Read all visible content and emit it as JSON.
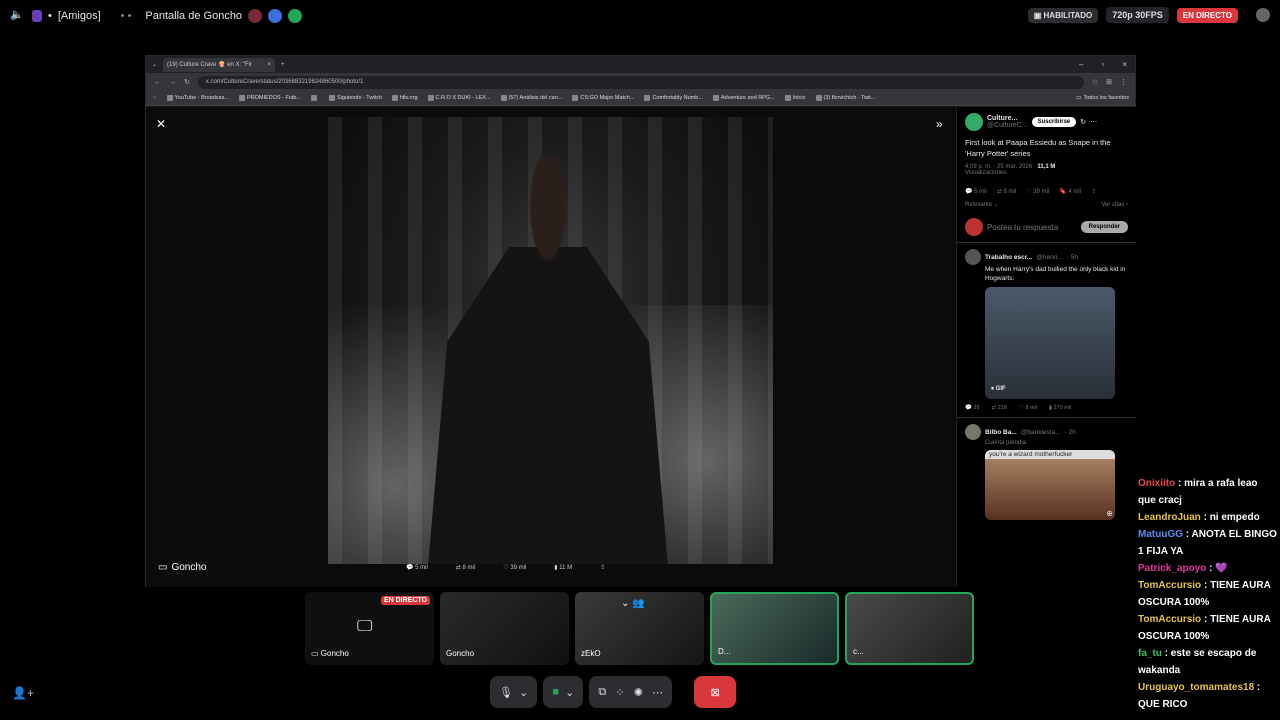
{
  "topbar": {
    "server": "[Amigos]",
    "separator": "•",
    "stream_title": "Pantalla de Goncho",
    "enabled_label": "HABILITADO",
    "quality": "720p 30FPS",
    "live_label": "EN DIRECTO"
  },
  "browser": {
    "tab_title": "(19) Culture Crave 🍿 en X: \"Fir",
    "url": "x.com/CultureCrave/status/2036883219824860500/photo/1",
    "bookmarks": [
      "YouTube - Broadcas...",
      "PROMIEDOS - Futb...",
      "",
      "Siguiendo - Twitch",
      "hltv.org",
      "C.R.O X DUKI - LEX...",
      "(57) Análisis del can...",
      "CS:GO Major Match...",
      "Comfortably Numb...",
      "Adventure and RPG...",
      "Inicio",
      "(3) florvichich - Twit..."
    ],
    "all_bookmarks": "Todos los favoritos",
    "stats": {
      "replies": "5 mil",
      "reposts": "8 mil",
      "likes": "39 mil",
      "views": "11 M"
    }
  },
  "sidebar": {
    "author": "Culture...",
    "handle": "@CultureC...",
    "subscribe": "Suscribirse",
    "tweet_text": "First look at Paapa Essiedu as Snape in the 'Harry Potter' series",
    "tweet_time": "4:09 p. m. · 25 mar. 2026 ·",
    "views_count": "11,1 M",
    "views_label": "Visualizaciones",
    "actions": {
      "replies": "5 mil",
      "reposts": "8 mil",
      "likes": "39 mil",
      "bookmarks": "4 mil"
    },
    "sort_label": "Relevante",
    "quotes_label": "Ver citas",
    "reply_placeholder": "Postea tu respuesta",
    "reply_button": "Responder",
    "reply1": {
      "name": "Trabalho escr...",
      "handle": "@henri...",
      "time": "· 5h",
      "text": "Me when Harry's dad bullied the only black kid in Hogwarts:",
      "gif": "GIF",
      "stats": {
        "replies": "39",
        "reposts": "228",
        "likes": "8 mil",
        "views": "270 mil"
      }
    },
    "reply2": {
      "name": "Bilbo Ba...",
      "handle": "@bankiesta...",
      "time": "· 2h",
      "tag": "Cuenta parodia",
      "media_caption": "you're a wizard motherfucker"
    }
  },
  "stage": {
    "streamer_name": "Goncho"
  },
  "tiles": [
    {
      "label": "Goncho",
      "live": "EN DIRECTO"
    },
    {
      "label": "Goncho"
    },
    {
      "label": "zEkO"
    },
    {
      "label": "D..."
    },
    {
      "label": "c..."
    }
  ],
  "chat": [
    {
      "user": "Onixiito",
      "color": "#e8474b",
      "text": "mira a rafa leao que cracj"
    },
    {
      "user": "LeandroJuan",
      "color": "#e5c24a",
      "text": "ni empedo"
    },
    {
      "user": "MatuuGG",
      "color": "#5b8fe8",
      "text": "ANOTA EL BINGO 1 FIJA YA"
    },
    {
      "user": "Patrick_apoyo",
      "color": "#e0339a",
      "text": "💜"
    },
    {
      "user": "TomAccursio",
      "color": "#e5c24a",
      "text": "TIENE AURA OSCURA 100%"
    },
    {
      "user": "TomAccursio",
      "color": "#e5c24a",
      "text": "TIENE AURA OSCURA 100%"
    },
    {
      "user": "fa_tu",
      "color": "#3fbf6b",
      "text": "este se escapo de wakanda"
    },
    {
      "user": "Uruguayo_tomamates18",
      "color": "#e5c24a",
      "text": "QUE RICO"
    }
  ]
}
